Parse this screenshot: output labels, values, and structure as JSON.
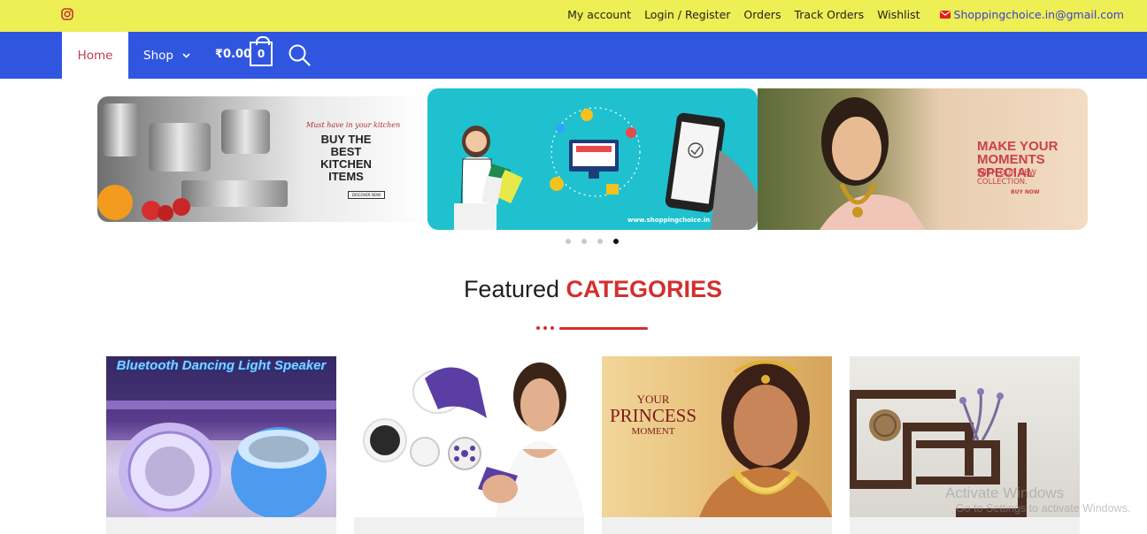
{
  "topbar": {
    "links": [
      "My account",
      "Login / Register",
      "Orders",
      "Track Orders",
      "Wishlist"
    ],
    "email": "Shoppingchoice.in@gmail.com"
  },
  "nav": {
    "home": "Home",
    "shop": "Shop",
    "cart_total": "₹0.00",
    "cart_count": "0"
  },
  "slider": {
    "slide1": {
      "tagline": "Must have in your kitchen",
      "headline": "BUY THE BEST KITCHEN ITEMS",
      "button": "DISCOVER NOW"
    },
    "slide2": {
      "website": "www.shoppingchoice.in"
    },
    "slide3": {
      "headline": "MAKE YOUR MOMENTS SPECIAL",
      "subline": "WITH OUR NEW COLLECTION.",
      "button": "BUY NOW"
    },
    "dot_count": 4,
    "active_dot": 4
  },
  "featured": {
    "heading_plain": "Featured",
    "heading_accent": "CATEGORIES"
  },
  "categories": [
    {
      "image_text": "Bluetooth Dancing Light Speaker"
    },
    {
      "image_text": ""
    },
    {
      "image_text_lines": [
        "YOUR",
        "PRINCESS",
        "MOMENT"
      ]
    },
    {
      "image_text": ""
    }
  ],
  "watermark": {
    "line1": "Activate Windows",
    "line2": "Go to Settings to activate Windows."
  },
  "colors": {
    "topbar": "#eeee55",
    "navbar": "#3056e0",
    "accent": "#d32f2f",
    "email_link": "#3a3fd0"
  },
  "icons": [
    "instagram-icon",
    "chevron-down-icon",
    "cart-icon",
    "search-icon",
    "mail-icon"
  ]
}
